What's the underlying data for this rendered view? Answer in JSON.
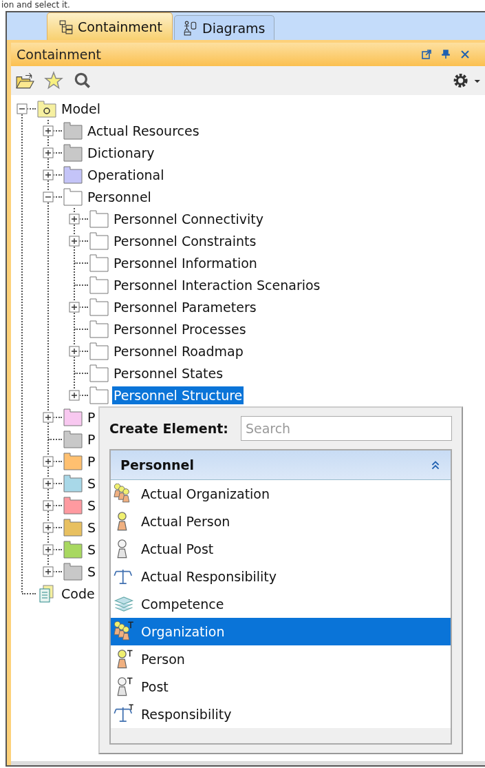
{
  "caption": "ion and select it.",
  "tabs": [
    {
      "label": "Containment",
      "kind": "containment",
      "selected": true
    },
    {
      "label": "Diagrams",
      "kind": "diagrams",
      "selected": false
    }
  ],
  "panel": {
    "title": "Containment"
  },
  "tree": [
    {
      "label": "Model",
      "kind": "model",
      "expanded": true,
      "selected": false,
      "children": [
        {
          "label": "Actual Resources",
          "kind": "folder",
          "color": "#c8c8c8",
          "expanded": false,
          "selected": false
        },
        {
          "label": "Dictionary",
          "kind": "folder",
          "color": "#c8c8c8",
          "expanded": false,
          "selected": false
        },
        {
          "label": "Operational",
          "kind": "folder",
          "color": "#c4c4f8",
          "expanded": false,
          "selected": false
        },
        {
          "label": "Personnel",
          "kind": "folder",
          "color": "#ffffff",
          "expanded": true,
          "selected": false,
          "children": [
            {
              "label": "Personnel Connectivity",
              "kind": "folder",
              "color": "#ffffff",
              "expanded": false,
              "selected": false
            },
            {
              "label": "Personnel Constraints",
              "kind": "folder",
              "color": "#ffffff",
              "expanded": false,
              "selected": false
            },
            {
              "label": "Personnel Information",
              "kind": "folder",
              "color": "#ffffff",
              "selected": false
            },
            {
              "label": "Personnel Interaction Scenarios",
              "kind": "folder",
              "color": "#ffffff",
              "selected": false
            },
            {
              "label": "Personnel Parameters",
              "kind": "folder",
              "color": "#ffffff",
              "expanded": false,
              "selected": false
            },
            {
              "label": "Personnel Processes",
              "kind": "folder",
              "color": "#ffffff",
              "selected": false
            },
            {
              "label": "Personnel Roadmap",
              "kind": "folder",
              "color": "#ffffff",
              "expanded": false,
              "selected": false
            },
            {
              "label": "Personnel States",
              "kind": "folder",
              "color": "#ffffff",
              "selected": false
            },
            {
              "label": "Personnel Structure",
              "kind": "folder",
              "color": "#ffffff",
              "expanded": false,
              "selected": true
            }
          ]
        },
        {
          "label": "P",
          "kind": "folder",
          "color": "#f8c8f0",
          "expanded": false,
          "selected": false
        },
        {
          "label": "P",
          "kind": "folder",
          "color": "#c8c8c8",
          "selected": false
        },
        {
          "label": "P",
          "kind": "folder",
          "color": "#ffc070",
          "expanded": false,
          "selected": false
        },
        {
          "label": "S",
          "kind": "folder",
          "color": "#a8d8e8",
          "expanded": false,
          "selected": false
        },
        {
          "label": "S",
          "kind": "folder",
          "color": "#ff9aa0",
          "expanded": false,
          "selected": false
        },
        {
          "label": "S",
          "kind": "folder",
          "color": "#e8c060",
          "expanded": false,
          "selected": false
        },
        {
          "label": "S",
          "kind": "folder",
          "color": "#a8d860",
          "expanded": false,
          "selected": false
        },
        {
          "label": "S",
          "kind": "folder",
          "color": "#c8c8c8",
          "expanded": false,
          "selected": false
        }
      ]
    },
    {
      "label": "Code",
      "kind": "code",
      "selected": false
    }
  ],
  "popup": {
    "title": "Create Element:",
    "search": {
      "placeholder": "Search"
    },
    "group": {
      "title": "Personnel",
      "expanded": true
    },
    "items": [
      {
        "label": "Actual Organization",
        "kind": "actual-organization",
        "selected": false
      },
      {
        "label": "Actual Person",
        "kind": "actual-person",
        "selected": false
      },
      {
        "label": "Actual Post",
        "kind": "actual-post",
        "selected": false
      },
      {
        "label": "Actual Responsibility",
        "kind": "actual-responsibility",
        "selected": false
      },
      {
        "label": "Competence",
        "kind": "competence",
        "selected": false
      },
      {
        "label": "Organization",
        "kind": "organization",
        "selected": true
      },
      {
        "label": "Person",
        "kind": "person",
        "selected": false
      },
      {
        "label": "Post",
        "kind": "post",
        "selected": false
      },
      {
        "label": "Responsibility",
        "kind": "responsibility",
        "selected": false
      }
    ]
  }
}
